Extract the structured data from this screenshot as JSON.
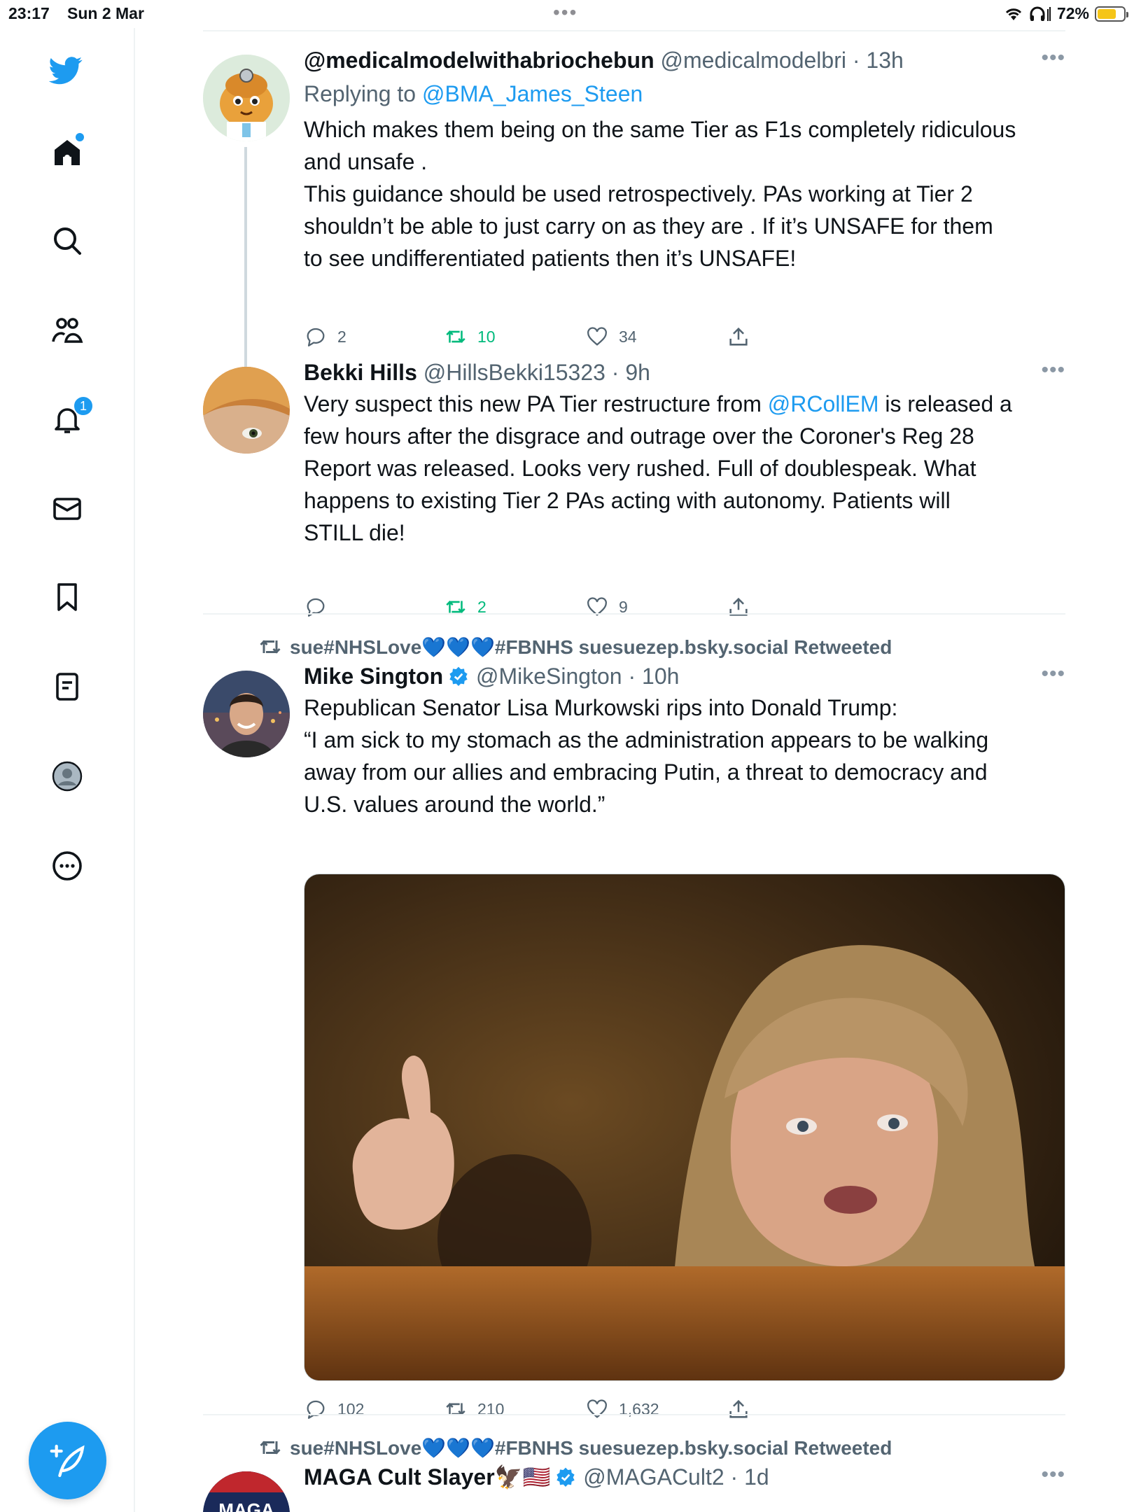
{
  "status_bar": {
    "time": "23:17",
    "date": "Sun 2 Mar",
    "battery": "72%",
    "battery_level": 0.72
  },
  "sidebar": {
    "notifications_badge": "1"
  },
  "tweets": [
    {
      "name": "@medicalmodelwithabriochebun",
      "handle": "@medicalmodelbri",
      "time": "· 13h",
      "replying_prefix": "Replying to",
      "replying_to": "@BMA_James_Steen",
      "text_lines": [
        "Which makes them being on the same Tier as F1s completely ridiculous",
        "and unsafe .",
        "This guidance should be used retrospectively. PAs working at Tier 2",
        "shouldn’t be able to just carry on as they are . If it’s UNSAFE for them",
        "to see undifferentiated patients then it’s UNSAFE!"
      ],
      "replies": "2",
      "retweets": "10",
      "likes": "34"
    },
    {
      "name": "Bekki Hills",
      "handle": "@HillsBekki15323",
      "time": "· 9h",
      "text_line1_before": "Very suspect this new PA Tier restructure from ",
      "mention": "@RCollEM",
      "text_line1_after": " is released a",
      "text_lines": [
        "few hours after the disgrace and outrage over the Coroner's Reg 28",
        "Report was released. Looks very rushed. Full of doublespeak. What",
        "happens to existing Tier 2 PAs acting with autonomy. Patients will",
        "STILL die!"
      ],
      "replies": "",
      "retweets": "2",
      "likes": "9"
    },
    {
      "retweeted_by": "sue#NHSLove💙💙💙#FBNHS suesuezep.bsky.social Retweeted",
      "name": "Mike Sington",
      "handle": "@MikeSington",
      "time": "· 10h",
      "text_lines": [
        "Republican Senator Lisa Murkowski rips into Donald Trump:",
        "“I am sick to my stomach as the administration appears to be walking",
        "away from our allies and embracing Putin, a threat to democracy and",
        "U.S. values around the world.”"
      ],
      "replies": "102",
      "retweets": "210",
      "likes": "1,632"
    },
    {
      "retweeted_by": "sue#NHSLove💙💙💙#FBNHS suesuezep.bsky.social Retweeted",
      "name": "MAGA Cult Slayer🦅🇺🇸",
      "handle": "@MAGACult2",
      "time": "· 1d",
      "avatar_text": "MAGA"
    }
  ]
}
